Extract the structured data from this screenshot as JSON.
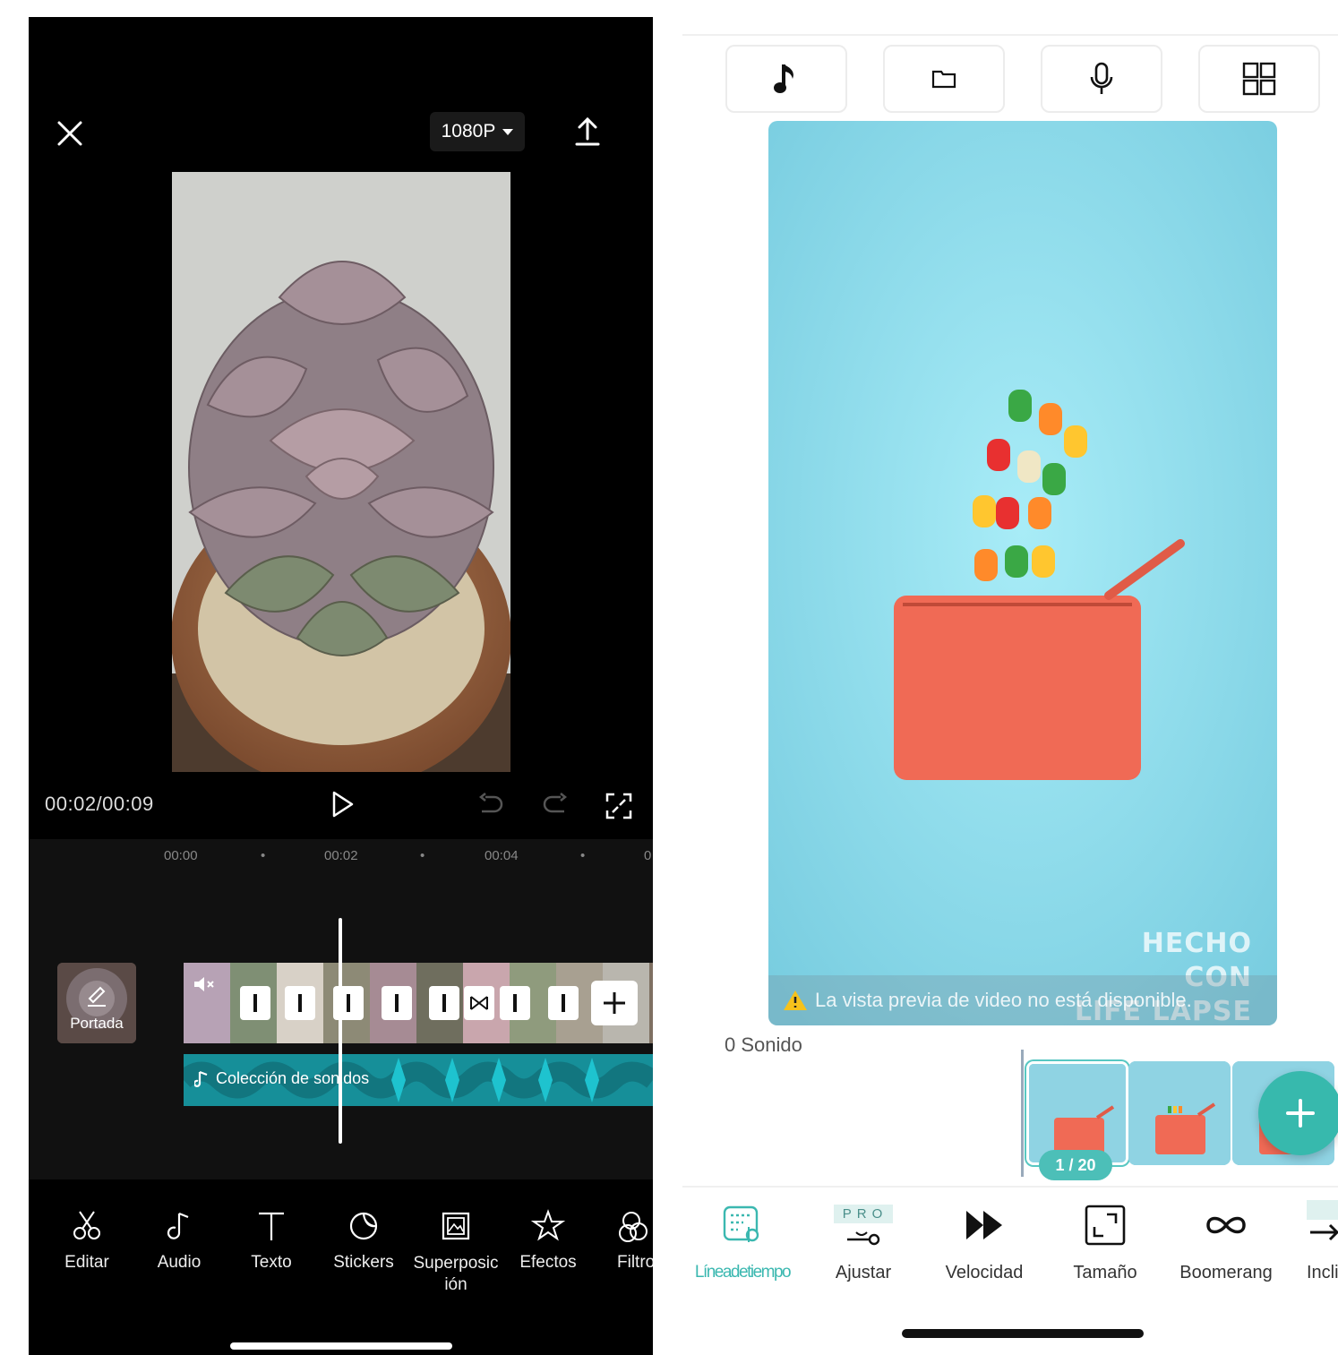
{
  "left_app": {
    "resolution": "1080P",
    "time_display": "00:02/00:09",
    "ruler_ticks": [
      "00:00",
      "•",
      "00:02",
      "•",
      "00:04",
      "•",
      "0"
    ],
    "cover_label": "Portada",
    "audio_track_label": "Colección de sonidos",
    "toolbar": [
      {
        "label": "Editar",
        "icon": "scissors-icon"
      },
      {
        "label": "Audio",
        "icon": "music-note-icon"
      },
      {
        "label": "Texto",
        "icon": "text-icon"
      },
      {
        "label": "Stickers",
        "icon": "sticker-icon"
      },
      {
        "label": "Superposic\nión",
        "icon": "overlay-icon"
      },
      {
        "label": "Efectos",
        "icon": "effects-star-icon"
      },
      {
        "label": "Filtro",
        "icon": "filter-icon"
      }
    ],
    "colors": {
      "accent": "#1b9aa6",
      "background": "#000000"
    }
  },
  "right_app": {
    "top_buttons": [
      {
        "name": "music",
        "icon": "music-note-icon"
      },
      {
        "name": "folder",
        "icon": "folder-icon"
      },
      {
        "name": "microphone",
        "icon": "microphone-icon"
      },
      {
        "name": "grid",
        "icon": "grid-icon"
      }
    ],
    "watermark_line1": "HECHO CON",
    "watermark_line2": "LIFE LAPSE",
    "warning_text": "La vista previa de video no está disponible.",
    "sound_label": "0 Sonido",
    "frame_counter": "1 / 20",
    "pro_badge": "PRO",
    "toolbar": [
      {
        "label": "Líneadetiempo",
        "icon": "timeline-icon"
      },
      {
        "label": "Ajustar",
        "icon": "adjust-icon"
      },
      {
        "label": "Velocidad",
        "icon": "fast-forward-icon"
      },
      {
        "label": "Tamaño",
        "icon": "resize-icon"
      },
      {
        "label": "Boomerang",
        "icon": "infinity-icon"
      },
      {
        "label": "Incli",
        "icon": "tilt-icon"
      }
    ],
    "colors": {
      "accent": "#3bb8b0",
      "preview_bg": "#8fd8ea",
      "bag": "#f06a55"
    }
  }
}
